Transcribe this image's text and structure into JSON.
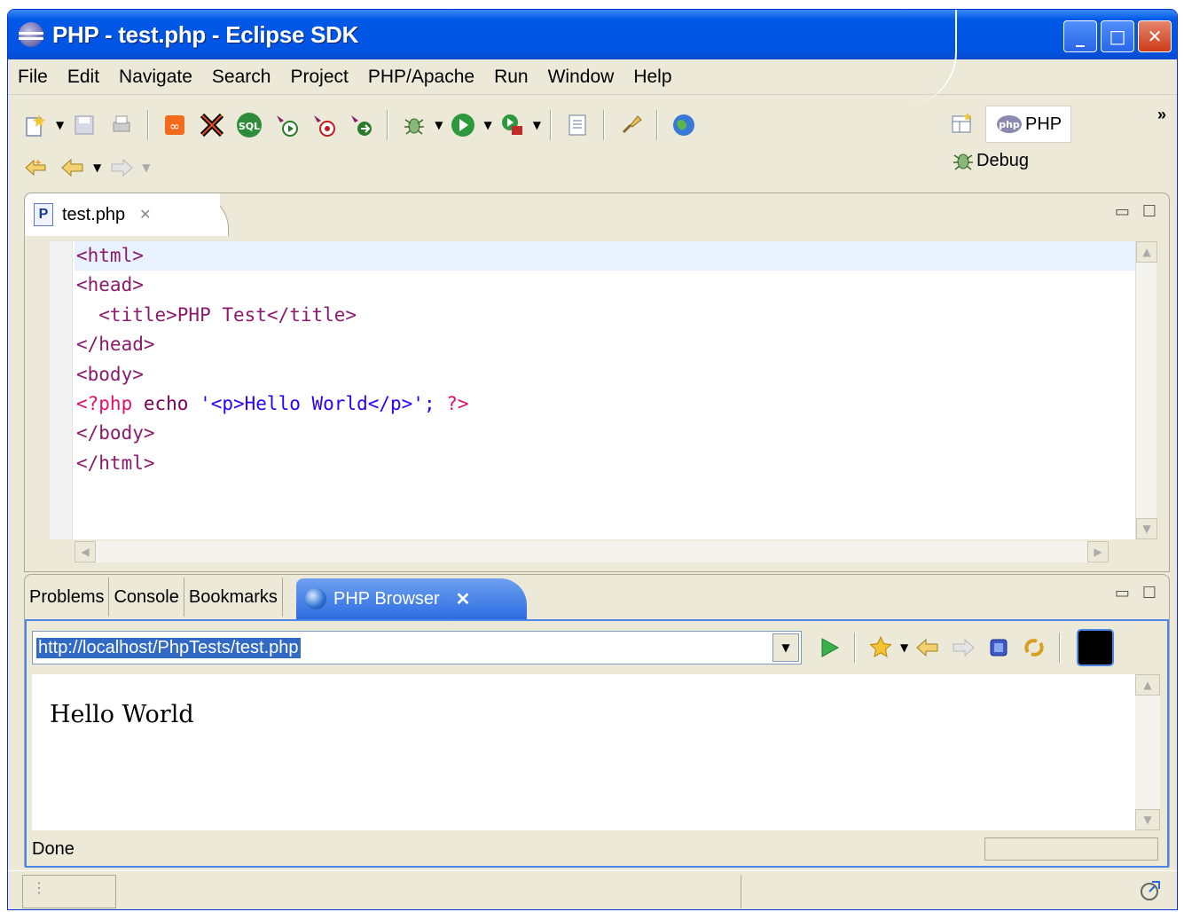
{
  "window": {
    "title": "PHP - test.php - Eclipse SDK",
    "min_label": "_",
    "max_label": "□",
    "close_label": "✕"
  },
  "menu": [
    "File",
    "Edit",
    "Navigate",
    "Search",
    "Project",
    "PHP/Apache",
    "Run",
    "Window",
    "Help"
  ],
  "perspectives": {
    "php_label": "PHP",
    "debug_label": "Debug",
    "more_label": "»"
  },
  "editor": {
    "tab_label": "test.php",
    "tab_close": "✕",
    "lines": [
      {
        "a": "<html>",
        "b": "",
        "c": "",
        "d": ""
      },
      {
        "a": "<head>",
        "b": "",
        "c": "",
        "d": ""
      },
      {
        "a": "  <title>PHP Test</title>",
        "b": "",
        "c": "",
        "d": ""
      },
      {
        "a": "</head>",
        "b": "",
        "c": "",
        "d": ""
      },
      {
        "a": "<body>",
        "b": "",
        "c": "",
        "d": ""
      },
      {
        "a": "",
        "b": "<?php ",
        "c": "echo ",
        "d": "'<p>Hello World</p>'; ",
        "e": "?>"
      },
      {
        "a": "</body>",
        "b": "",
        "c": "",
        "d": ""
      },
      {
        "a": "</html>",
        "b": "",
        "c": "",
        "d": ""
      }
    ]
  },
  "bottom_tabs": [
    "Problems",
    "Console",
    "Bookmarks"
  ],
  "browser": {
    "tab_label": "PHP Browser",
    "tab_close": "✕",
    "url": "http://localhost/PhpTests/test.php",
    "page_text": "Hello World",
    "status": "Done"
  }
}
